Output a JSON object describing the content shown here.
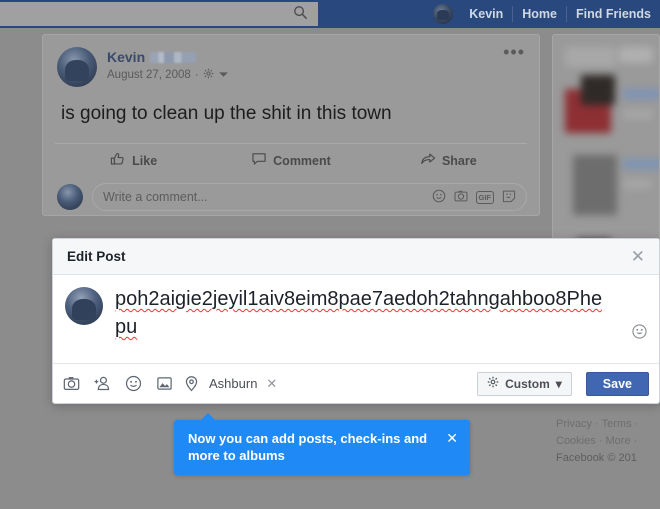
{
  "topbar": {
    "search_placeholder": "",
    "search_icon": "search-icon",
    "profile_name": "Kevin",
    "home_label": "Home",
    "find_friends_label": "Find Friends"
  },
  "post": {
    "author": "Kevin",
    "author_surname_blurred": true,
    "date": "August 27, 2008",
    "separator": "·",
    "privacy_icon": "gear-icon",
    "dropdown_icon": "chevron-down-icon",
    "more_icon": "ellipsis-icon",
    "text": "is going to clean up the shit in this town",
    "actions": [
      {
        "label": "Like",
        "icon": "thumbs-up-icon"
      },
      {
        "label": "Comment",
        "icon": "speech-bubble-icon"
      },
      {
        "label": "Share",
        "icon": "share-arrow-icon"
      }
    ],
    "comment_placeholder": "Write a comment...",
    "comment_icons": [
      "emoji-icon",
      "camera-icon",
      "gif-icon",
      "sticker-icon"
    ]
  },
  "sidebar": {
    "footer_line1": "Privacy · Terms ·",
    "footer_line2": "Cookies · More ·",
    "footer_line3": "Facebook © 201"
  },
  "modal": {
    "title": "Edit Post",
    "close_icon": "close-icon",
    "post_text": "poh2aigie2jeyil1aiv8eim8pae7aedoh2tahngahboo8Phepu",
    "emoji_icon": "emoji-icon",
    "toolbar_icons": [
      "camera-icon",
      "tag-person-icon",
      "emoji-icon",
      "album-icon",
      "location-pin-icon"
    ],
    "location": "Ashburn",
    "location_remove_icon": "close-icon",
    "privacy_label": "Custom",
    "privacy_icon": "gear-icon",
    "privacy_caret": "▾",
    "save_label": "Save"
  },
  "tooltip": {
    "text": "Now you can add posts, check-ins and more to albums",
    "close_icon": "close-icon"
  },
  "colors": {
    "nav_blue": "#29487d",
    "save_blue": "#4267b2",
    "tooltip_blue": "#1f8af5",
    "spellcheck_red": "#ff2f2f",
    "dim_overlay": "#8c8c8c"
  }
}
